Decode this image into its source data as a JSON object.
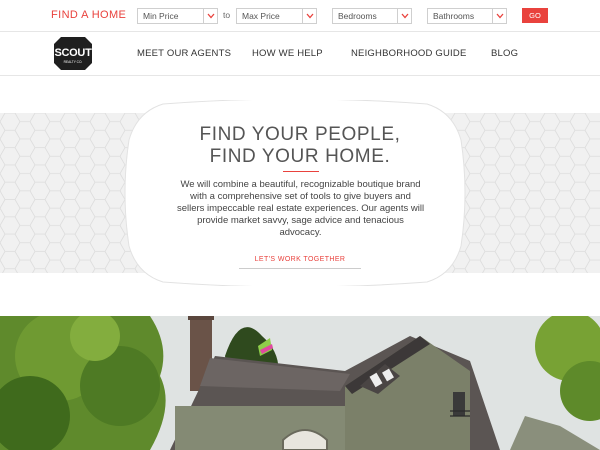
{
  "search": {
    "find_label": "FIND A HOME",
    "min_price": "Min Price",
    "to_label": "to",
    "max_price": "Max Price",
    "bedrooms": "Bedrooms",
    "bathrooms": "Bathrooms",
    "go_label": "GO"
  },
  "logo": {
    "name": "SCOUT",
    "tagline": "REALTY CO."
  },
  "nav": {
    "items": [
      {
        "label": "MEET OUR AGENTS"
      },
      {
        "label": "HOW WE HELP"
      },
      {
        "label": "NEIGHBORHOOD GUIDE"
      },
      {
        "label": "BLOG"
      }
    ]
  },
  "hero": {
    "headline_line1": "FIND YOUR PEOPLE,",
    "headline_line2": "FIND YOUR HOME.",
    "body": "We will combine a beautiful, recognizable boutique brand with a comprehensive set of tools to give buyers and sellers impeccable real estate experiences. Our agents will provide market savvy, sage advice and tenacious advocacy.",
    "cta": "LET'S WORK TOGETHER"
  },
  "colors": {
    "accent": "#e9423d",
    "text": "#333333",
    "hero_bg": "#f1f1f1"
  }
}
